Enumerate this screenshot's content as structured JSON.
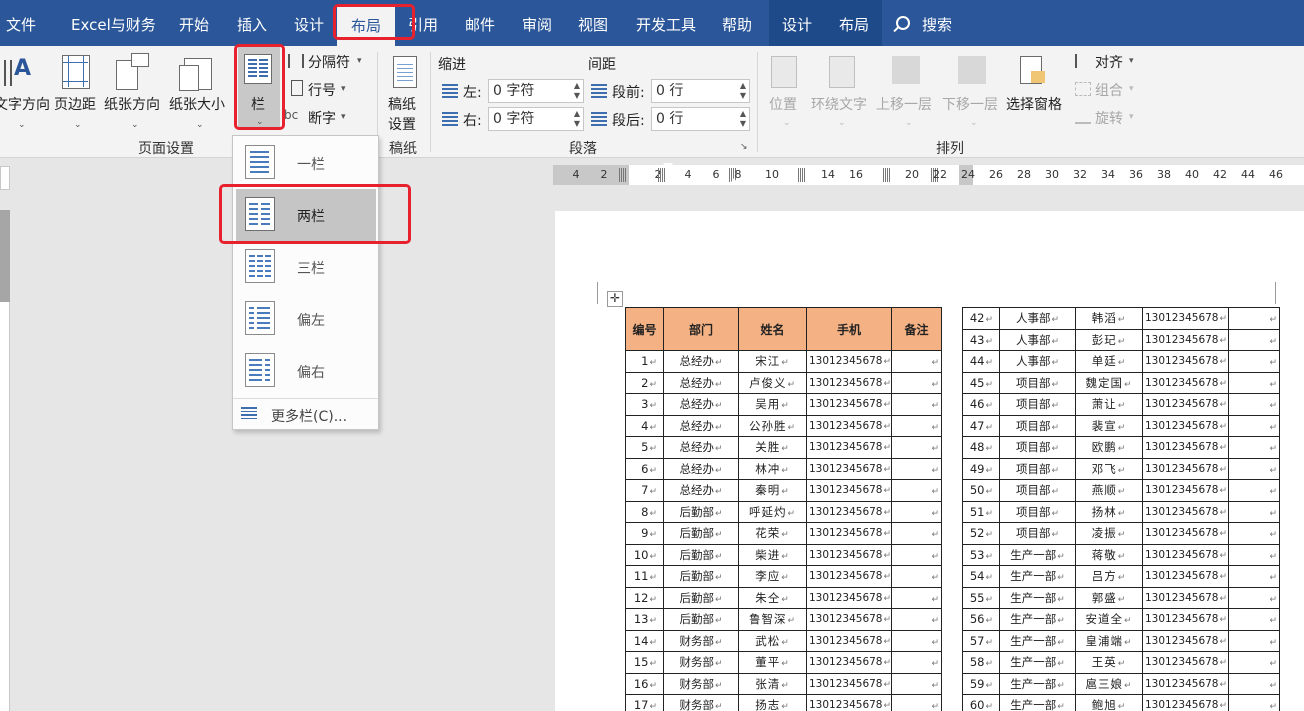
{
  "menu": {
    "tabs": [
      "文件",
      "Excel与财务",
      "开始",
      "插入",
      "设计",
      "布局",
      "引用",
      "邮件",
      "审阅",
      "视图",
      "开发工具",
      "帮助",
      "设计",
      "布局"
    ],
    "active_tab": "布局",
    "search_label": "搜索"
  },
  "ribbon": {
    "page_setup": {
      "group_label": "页面设置",
      "text_direction": "文字方向",
      "margins": "页边距",
      "orientation": "纸张方向",
      "size": "纸张大小",
      "columns": "栏",
      "breaks": "分隔符",
      "line_numbers": "行号",
      "hyphenation": "断字"
    },
    "manuscript": {
      "group_label": "稿纸",
      "button_line1": "稿纸",
      "button_line2": "设置"
    },
    "paragraph": {
      "group_label": "段落",
      "indent_label": "缩进",
      "spacing_label": "间距",
      "left_label": "左:",
      "right_label": "右:",
      "before_label": "段前:",
      "after_label": "段后:",
      "left_value": "0 字符",
      "right_value": "0 字符",
      "before_value": "0 行",
      "after_value": "0 行"
    },
    "arrange": {
      "group_label": "排列",
      "position": "位置",
      "wrap_text": "环绕文字",
      "bring_forward": "上移一层",
      "send_backward": "下移一层",
      "selection_pane": "选择窗格",
      "align": "对齐",
      "group": "组合",
      "rotate": "旋转"
    }
  },
  "columns_dropdown": {
    "items": [
      "一栏",
      "两栏",
      "三栏",
      "偏左",
      "偏右"
    ],
    "highlighted": "两栏",
    "more": "更多栏(C)..."
  },
  "ruler": {
    "numbers": [
      "4",
      "2",
      "2",
      "4",
      "6",
      "8",
      "10",
      "14",
      "16",
      "20",
      "22",
      "24",
      "26",
      "28",
      "30",
      "32",
      "34",
      "36",
      "38",
      "40",
      "42",
      "44",
      "46"
    ]
  },
  "document": {
    "headers": [
      "编号",
      "部门",
      "姓名",
      "手机",
      "备注"
    ],
    "left_rows": [
      [
        "1",
        "总经办",
        "宋江",
        "13012345678"
      ],
      [
        "2",
        "总经办",
        "卢俊义",
        "13012345678"
      ],
      [
        "3",
        "总经办",
        "吴用",
        "13012345678"
      ],
      [
        "4",
        "总经办",
        "公孙胜",
        "13012345678"
      ],
      [
        "5",
        "总经办",
        "关胜",
        "13012345678"
      ],
      [
        "6",
        "总经办",
        "林冲",
        "13012345678"
      ],
      [
        "7",
        "总经办",
        "秦明",
        "13012345678"
      ],
      [
        "8",
        "后勤部",
        "呼延灼",
        "13012345678"
      ],
      [
        "9",
        "后勤部",
        "花荣",
        "13012345678"
      ],
      [
        "10",
        "后勤部",
        "柴进",
        "13012345678"
      ],
      [
        "11",
        "后勤部",
        "李应",
        "13012345678"
      ],
      [
        "12",
        "后勤部",
        "朱仝",
        "13012345678"
      ],
      [
        "13",
        "后勤部",
        "鲁智深",
        "13012345678"
      ],
      [
        "14",
        "财务部",
        "武松",
        "13012345678"
      ],
      [
        "15",
        "财务部",
        "董平",
        "13012345678"
      ],
      [
        "16",
        "财务部",
        "张清",
        "13012345678"
      ],
      [
        "17",
        "财务部",
        "扬志",
        "13012345678"
      ]
    ],
    "right_rows": [
      [
        "42",
        "人事部",
        "韩滔",
        "13012345678"
      ],
      [
        "43",
        "人事部",
        "彭玘",
        "13012345678"
      ],
      [
        "44",
        "人事部",
        "单廷",
        "13012345678"
      ],
      [
        "45",
        "项目部",
        "魏定国",
        "13012345678"
      ],
      [
        "46",
        "项目部",
        "萧让",
        "13012345678"
      ],
      [
        "47",
        "项目部",
        "裴宣",
        "13012345678"
      ],
      [
        "48",
        "项目部",
        "欧鹏",
        "13012345678"
      ],
      [
        "49",
        "项目部",
        "邓飞",
        "13012345678"
      ],
      [
        "50",
        "项目部",
        "燕顺",
        "13012345678"
      ],
      [
        "51",
        "项目部",
        "扬林",
        "13012345678"
      ],
      [
        "52",
        "项目部",
        "凌振",
        "13012345678"
      ],
      [
        "53",
        "生产一部",
        "蒋敬",
        "13012345678"
      ],
      [
        "54",
        "生产一部",
        "吕方",
        "13012345678"
      ],
      [
        "55",
        "生产一部",
        "郭盛",
        "13012345678"
      ],
      [
        "56",
        "生产一部",
        "安道全",
        "13012345678"
      ],
      [
        "57",
        "生产一部",
        "皇浦端",
        "13012345678"
      ],
      [
        "58",
        "生产一部",
        "王英",
        "13012345678"
      ],
      [
        "59",
        "生产一部",
        "扈三娘",
        "13012345678"
      ],
      [
        "60",
        "生产一部",
        "鲍旭",
        "13012345678"
      ]
    ],
    "paragraph_mark": "↵"
  },
  "colors": {
    "ribbon_blue": "#2b579a",
    "header_fill": "#f4b183",
    "highlight_red": "#e8212f"
  }
}
